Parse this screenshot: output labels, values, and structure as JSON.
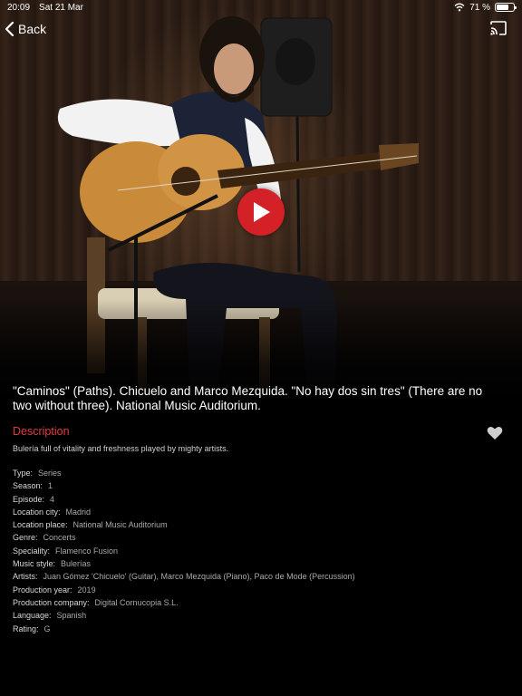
{
  "status_bar": {
    "time": "20:09",
    "date": "Sat 21 Mar",
    "battery": "71 %",
    "battery_level": 0.71
  },
  "nav": {
    "back_label": "Back"
  },
  "video": {
    "title": "\"Caminos\" (Paths). Chicuelo and Marco Mezquida. \"No hay dos sin tres\" (There are no two without three). National Music Auditorium."
  },
  "description": {
    "heading": "Description",
    "text": "Bulería full of vitality and freshness played by mighty artists."
  },
  "details": [
    {
      "label": "Type:",
      "value": "Series"
    },
    {
      "label": "Season:",
      "value": "1"
    },
    {
      "label": "Episode:",
      "value": "4"
    },
    {
      "label": "Location city:",
      "value": "Madrid"
    },
    {
      "label": "Location place:",
      "value": "National Music Auditorium"
    },
    {
      "label": "Genre:",
      "value": "Concerts"
    },
    {
      "label": "Speciality:",
      "value": "Flamenco Fusion"
    },
    {
      "label": "Music style:",
      "value": "Bulerías"
    },
    {
      "label": "Artists:",
      "value": "Juan Gómez 'Chicuelo' (Guitar), Marco Mezquida (Piano), Paco de Mode (Percussion)"
    },
    {
      "label": "Production year:",
      "value": "2019"
    },
    {
      "label": "Production company:",
      "value": "Digital Cornucopia S.L."
    },
    {
      "label": "Language:",
      "value": "Spanish"
    },
    {
      "label": "Rating:",
      "value": "G"
    }
  ],
  "colors": {
    "accent": "#e23a3f",
    "play": "#d42128",
    "background": "#000000"
  },
  "icons": {
    "back": "chevron-left-icon",
    "cast": "cast-icon",
    "play": "play-icon",
    "favorite": "heart-icon",
    "wifi": "wifi-icon",
    "battery": "battery-icon"
  }
}
